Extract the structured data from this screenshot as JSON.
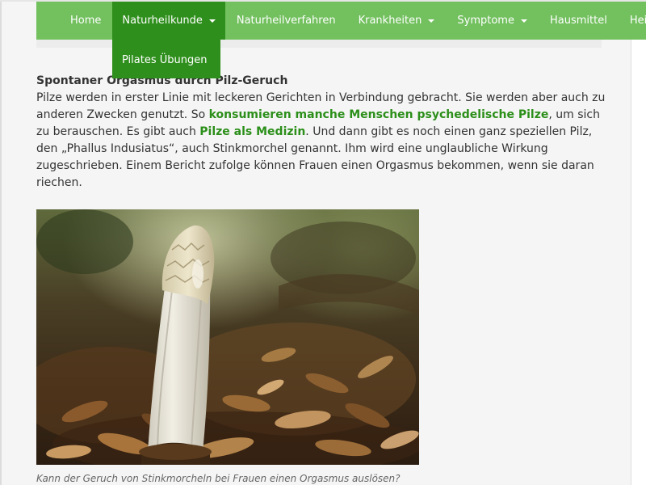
{
  "nav": {
    "items": [
      {
        "label": "Home"
      },
      {
        "label": "Naturheilkunde"
      },
      {
        "label": "Naturheilverfahren"
      },
      {
        "label": "Krankheiten"
      },
      {
        "label": "Symptome"
      },
      {
        "label": "Hausmittel"
      },
      {
        "label": "Heilpra"
      }
    ],
    "dropdown": {
      "items": [
        {
          "label": "Pilates Übungen"
        }
      ]
    }
  },
  "article": {
    "heading": "Spontaner Orgasmus durch Pilz-Geruch",
    "p1": "Pilze werden in erster Linie mit leckeren Gerichten in Verbindung gebracht. Sie werden aber auch zu anderen Zwecken genutzt. So ",
    "link1": "konsumieren manche Menschen psychedelische Pilze",
    "p2": ", um sich zu berauschen. Es gibt auch ",
    "link2": "Pilze als Medizin",
    "p3": ".  Und dann gibt es noch einen ganz speziellen Pilz, den „Phallus Indusiatus“, auch Stinkmorchel genannt. Ihm wird eine unglaubliche Wirkung zugeschrieben. Einem Bericht zufolge können Frauen einen Orgasmus bekommen, wenn sie daran riechen.",
    "caption": "Kann der Geruch von Stinkmorcheln bei Frauen einen Orgasmus auslösen?"
  },
  "colors": {
    "nav_bg": "#72c05e",
    "nav_active": "#2f8f1c",
    "link": "#2c8f1a"
  }
}
